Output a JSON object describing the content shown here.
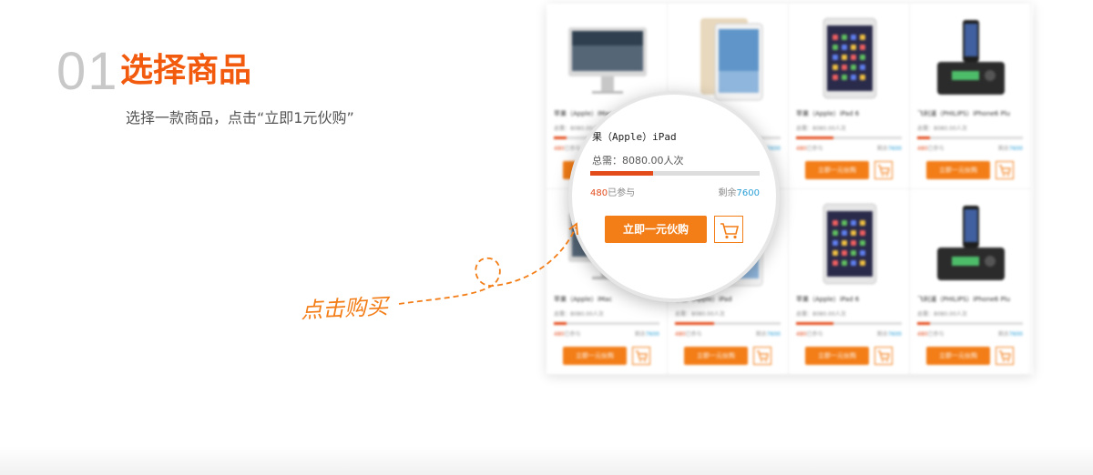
{
  "step": {
    "number": "01",
    "title": "选择商品",
    "description": "选择一款商品，点击“立即1元伙购”"
  },
  "colors": {
    "accent": "#f25a0e",
    "button": "#f37d17",
    "progress": "#e34b1b",
    "remain": "#2a9fd6"
  },
  "magnifier": {
    "name": "果（Apple）iPad",
    "total": "总需：8080.00人次",
    "progress": 0.37,
    "joined_count": "480",
    "joined_label": "已参与",
    "remain_label": "剩余",
    "remain_count": "7600",
    "buy_label": "立即一元伙购",
    "cart_icon": "cart-icon"
  },
  "annotation": {
    "label": "点击购买"
  },
  "products": [
    {
      "name": "苹果（Apple）iMac",
      "total": "总需：8080.00人次",
      "joined_count": "480",
      "joined_label": "已参与",
      "remain_label": "剩余",
      "remain_count": "7600",
      "buy_label": "立即一元伙购",
      "kind": "imac",
      "progress": 0.12
    },
    {
      "name": "苹果（Apple）iPad",
      "total": "总需：8080.00人次",
      "joined_count": "480",
      "joined_label": "已参与",
      "remain_label": "剩余",
      "remain_count": "7600",
      "buy_label": "立即一元伙购",
      "kind": "ipad-gold",
      "progress": 0.37
    },
    {
      "name": "苹果（Apple）iPad 6",
      "total": "总需：8080.00人次",
      "joined_count": "480",
      "joined_label": "已参与",
      "remain_label": "剩余",
      "remain_count": "7600",
      "buy_label": "立即一元伙购",
      "kind": "ipad",
      "progress": 0.35
    },
    {
      "name": "飞利浦（PHILIPS）iPhone6 Plu",
      "total": "总需：8080.00人次",
      "joined_count": "480",
      "joined_label": "已参与",
      "remain_label": "剩余",
      "remain_count": "7600",
      "buy_label": "立即一元伙购",
      "kind": "dock",
      "progress": 0.12
    },
    {
      "name": "苹果（Apple）iMac",
      "total": "总需：8080.00人次",
      "joined_count": "480",
      "joined_label": "已参与",
      "remain_label": "剩余",
      "remain_count": "7600",
      "buy_label": "立即一元伙购",
      "kind": "imac",
      "progress": 0.12
    },
    {
      "name": "苹果（Apple）iPad",
      "total": "总需：8080.00人次",
      "joined_count": "480",
      "joined_label": "已参与",
      "remain_label": "剩余",
      "remain_count": "7600",
      "buy_label": "立即一元伙购",
      "kind": "ipad-gold",
      "progress": 0.37
    },
    {
      "name": "苹果（Apple）iPad 6",
      "total": "总需：8080.00人次",
      "joined_count": "480",
      "joined_label": "已参与",
      "remain_label": "剩余",
      "remain_count": "7600",
      "buy_label": "立即一元伙购",
      "kind": "ipad",
      "progress": 0.35
    },
    {
      "name": "飞利浦（PHILIPS）iPhone6 Plu",
      "total": "总需：8080.00人次",
      "joined_count": "480",
      "joined_label": "已参与",
      "remain_label": "剩余",
      "remain_count": "7600",
      "buy_label": "立即一元伙购",
      "kind": "dock",
      "progress": 0.12
    }
  ]
}
